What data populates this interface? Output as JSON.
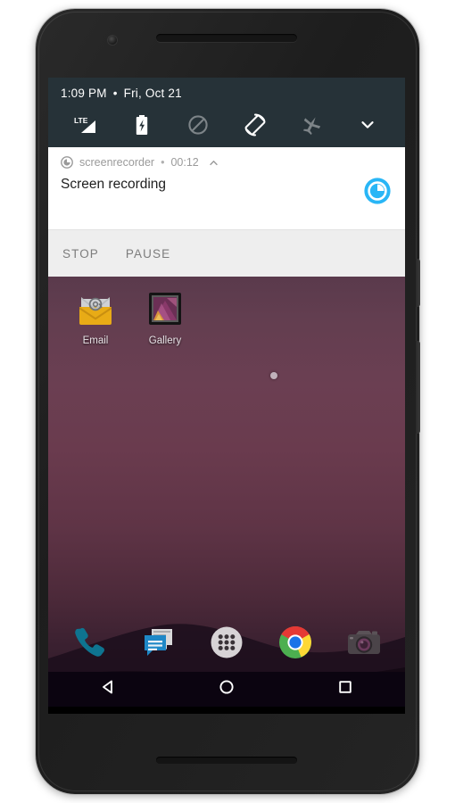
{
  "device": {
    "name": "android-phone",
    "earpiece": "earpiece-speaker",
    "front_camera": "front-camera",
    "bottom_speaker": "bottom-speaker",
    "power_button": "power-button",
    "volume_button": "volume-rocker"
  },
  "colors": {
    "statusbar_bg": "#263238",
    "notification_bg": "#ffffff",
    "action_bar_bg": "#eeeeee",
    "accent_app_icon": "#29b6f6",
    "navbar_bg": "#0b0410",
    "wallpaper_top": "#5a3a4c",
    "wallpaper_bottom": "#2c1a26"
  },
  "statusbar": {
    "time": "1:09 PM",
    "separator": "•",
    "date": "Fri, Oct 21"
  },
  "quicksettings": {
    "tiles": [
      {
        "icon": "lte-signal-icon",
        "label": "LTE",
        "active": true
      },
      {
        "icon": "battery-charging-icon",
        "label": "Battery charging",
        "active": true
      },
      {
        "icon": "do-not-disturb-icon",
        "label": "Do not disturb",
        "active": false
      },
      {
        "icon": "auto-rotate-icon",
        "label": "Auto-rotate",
        "active": true
      },
      {
        "icon": "airplane-mode-icon",
        "label": "Airplane mode",
        "active": false
      },
      {
        "icon": "chevron-down-icon",
        "label": "Expand",
        "active": true
      }
    ]
  },
  "notification": {
    "app_name": "screenrecorder",
    "separator": "•",
    "elapsed": "00:12",
    "collapse_icon": "chevron-up-icon",
    "app_icon": "screenrecorder-app-icon",
    "title": "Screen recording",
    "actions": [
      {
        "label": "STOP",
        "name": "stop-button"
      },
      {
        "label": "PAUSE",
        "name": "pause-button"
      }
    ]
  },
  "homescreen": {
    "apps": [
      {
        "label": "Email",
        "icon": "email-icon"
      },
      {
        "label": "Gallery",
        "icon": "gallery-icon"
      }
    ],
    "page_indicator": {
      "pages": 1,
      "current": 1
    },
    "dock": [
      {
        "label": "Phone",
        "icon": "phone-icon"
      },
      {
        "label": "Messaging",
        "icon": "messaging-icon"
      },
      {
        "label": "Apps",
        "icon": "app-drawer-icon"
      },
      {
        "label": "Chrome",
        "icon": "chrome-icon"
      },
      {
        "label": "Camera",
        "icon": "camera-icon"
      }
    ]
  },
  "navbar": {
    "buttons": [
      {
        "label": "Back",
        "icon": "back-triangle-icon"
      },
      {
        "label": "Home",
        "icon": "home-circle-icon"
      },
      {
        "label": "Recents",
        "icon": "recents-square-icon"
      }
    ]
  }
}
